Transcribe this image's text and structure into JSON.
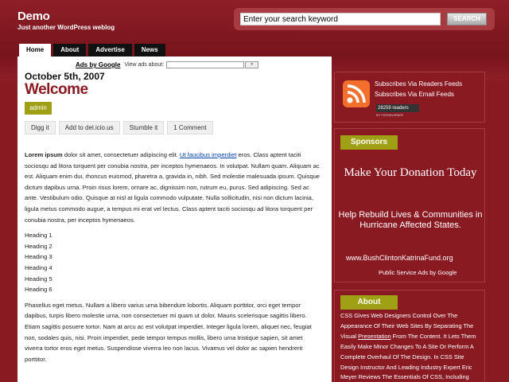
{
  "header": {
    "title": "Demo",
    "tagline": "Just another WordPress weblog"
  },
  "search": {
    "placeholder": "Enter your search keyword",
    "button": "SEARCH"
  },
  "nav": {
    "tabs": [
      "Home",
      "About",
      "Advertise",
      "News"
    ]
  },
  "ads": {
    "link": "Ads by Google",
    "label": "View ads about:",
    "go": "»"
  },
  "post": {
    "date": "October 5th, 2007",
    "title": "Welcome",
    "author": "admin",
    "actions": [
      "Digg it",
      "Add to del.icio.us",
      "Stumble it",
      "1 Comment"
    ],
    "para1_lead": "Lorem ipsum",
    "para1_a": " dolor sit amet, consectetuer adipiscing elit. ",
    "para1_link": "Ut faucibus imperdiet",
    "para1_b": " eros. Class aptent taciti sociosqu ad litora torquent per conubia nostra, per inceptos hymenaeos. In volutpat. Nullam quam. Aliquam ac est. Aliquam enim dui, rhoncus euismod, pharetra a, gravida in, nibh. Sed molestie malesuada ipsum. Quisque dictum dapibus urna. Proin risus lorem, ornare ac, dignissim non, rutrum eu, purus. Sed adipiscing. Sed ac ante. Vestibulum odio. Quisque at nisl at ligula commodo vulputate. Nulla sollicitudin, nisi non dictum lacinia, ligula metus commodo augue, a tempus mi erat vel lectus. Class aptent taciti sociosqu ad litora torquent per conubia nostra, per inceptos hymenaeos.",
    "headings": [
      "Heading 1",
      "Heading 2",
      "Heading 3",
      "Heading 4",
      "Heading 5",
      "Heading 6"
    ],
    "para2": "Phasellus eget metus. Nullam a libero varius urna bibendum lobortis. Aliquam porttitor, orci eget tempor dapibus, turpis libero molestie urna, non consectetuer mi quam ut dolor. Mauris scelerisque sagittis libero. Etiam sagittis posuere tortor. Nam at arcu ac est volutpat imperdiet. Integer ligula lorem, aliquet nec, feugiat non, sodales quis, nisi. Proin imperdiet, pede tempor tempus mollis, libero urna tristique sapien, sit amet viverra tortor eros eget metus. Suspendisse viverra leo non lacus. Vivamus vel dolor ac sapien hendrerit porttitor."
  },
  "sidebar": {
    "rss": {
      "readers_feeds": "Subscribes Via Readers Feeds",
      "email_feeds": "Subscribes Via Email Feeds",
      "readers_count": "28259 readers",
      "badge_sub": "BY FEEDBURNER"
    },
    "sponsors": {
      "label": "Sponsors",
      "title": "Make Your Donation Today",
      "subtitle": "Help Rebuild Lives & Communities in Hurricane Affected States.",
      "url": "www.BushClintonKatrinaFund.org",
      "psa": "Public Service Ads by Google"
    },
    "about": {
      "label": "About",
      "text_a": "CSS Gives Web Designers Control Over The Appearance Of Their Web Sites By Separating The Visual ",
      "link": "Presentation",
      "text_b": " From The Content. It Lets Them Easily Make Minor Changes To A Site Or Perform A Complete Overhaul Of The Design. In CSS Site Design Instructor And Leading Industry Expert Eric Meyer Reviews The Essentials Of CSS, Including Selectors"
    }
  }
}
